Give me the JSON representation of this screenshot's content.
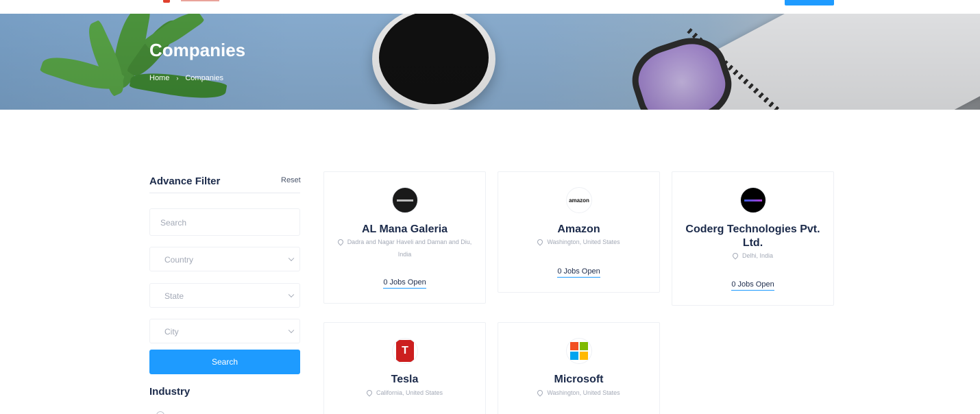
{
  "hero": {
    "title": "Companies",
    "breadcrumb": [
      "Home",
      "Companies"
    ]
  },
  "filter": {
    "title": "Advance Filter",
    "reset_label": "Reset",
    "search_placeholder": "Search",
    "country_placeholder": "Country",
    "state_placeholder": "State",
    "city_placeholder": "City",
    "search_button": "Search",
    "industry_title": "Industry"
  },
  "companies": [
    {
      "name": "AL Mana Galeria",
      "location": "Dadra and Nagar Haveli and Daman and Diu, India",
      "jobs": "0 Jobs Open",
      "logo": "al-mana-logo"
    },
    {
      "name": "Amazon",
      "location": "Washington, United States",
      "jobs": "0 Jobs Open",
      "logo": "amazon-logo",
      "logo_text": "amazon"
    },
    {
      "name": "Coderg Technologies Pvt. Ltd.",
      "location": "Delhi, India",
      "jobs": "0 Jobs Open",
      "logo": "coderg-logo"
    },
    {
      "name": "Tesla",
      "location": "California, United States",
      "logo": "tesla-logo",
      "logo_text": "T"
    },
    {
      "name": "Microsoft",
      "location": "Washington, United States",
      "logo": "microsoft-logo"
    }
  ],
  "colors": {
    "accent": "#1e9bff",
    "heading": "#1b2a4a",
    "muted": "#a3a9b6"
  }
}
